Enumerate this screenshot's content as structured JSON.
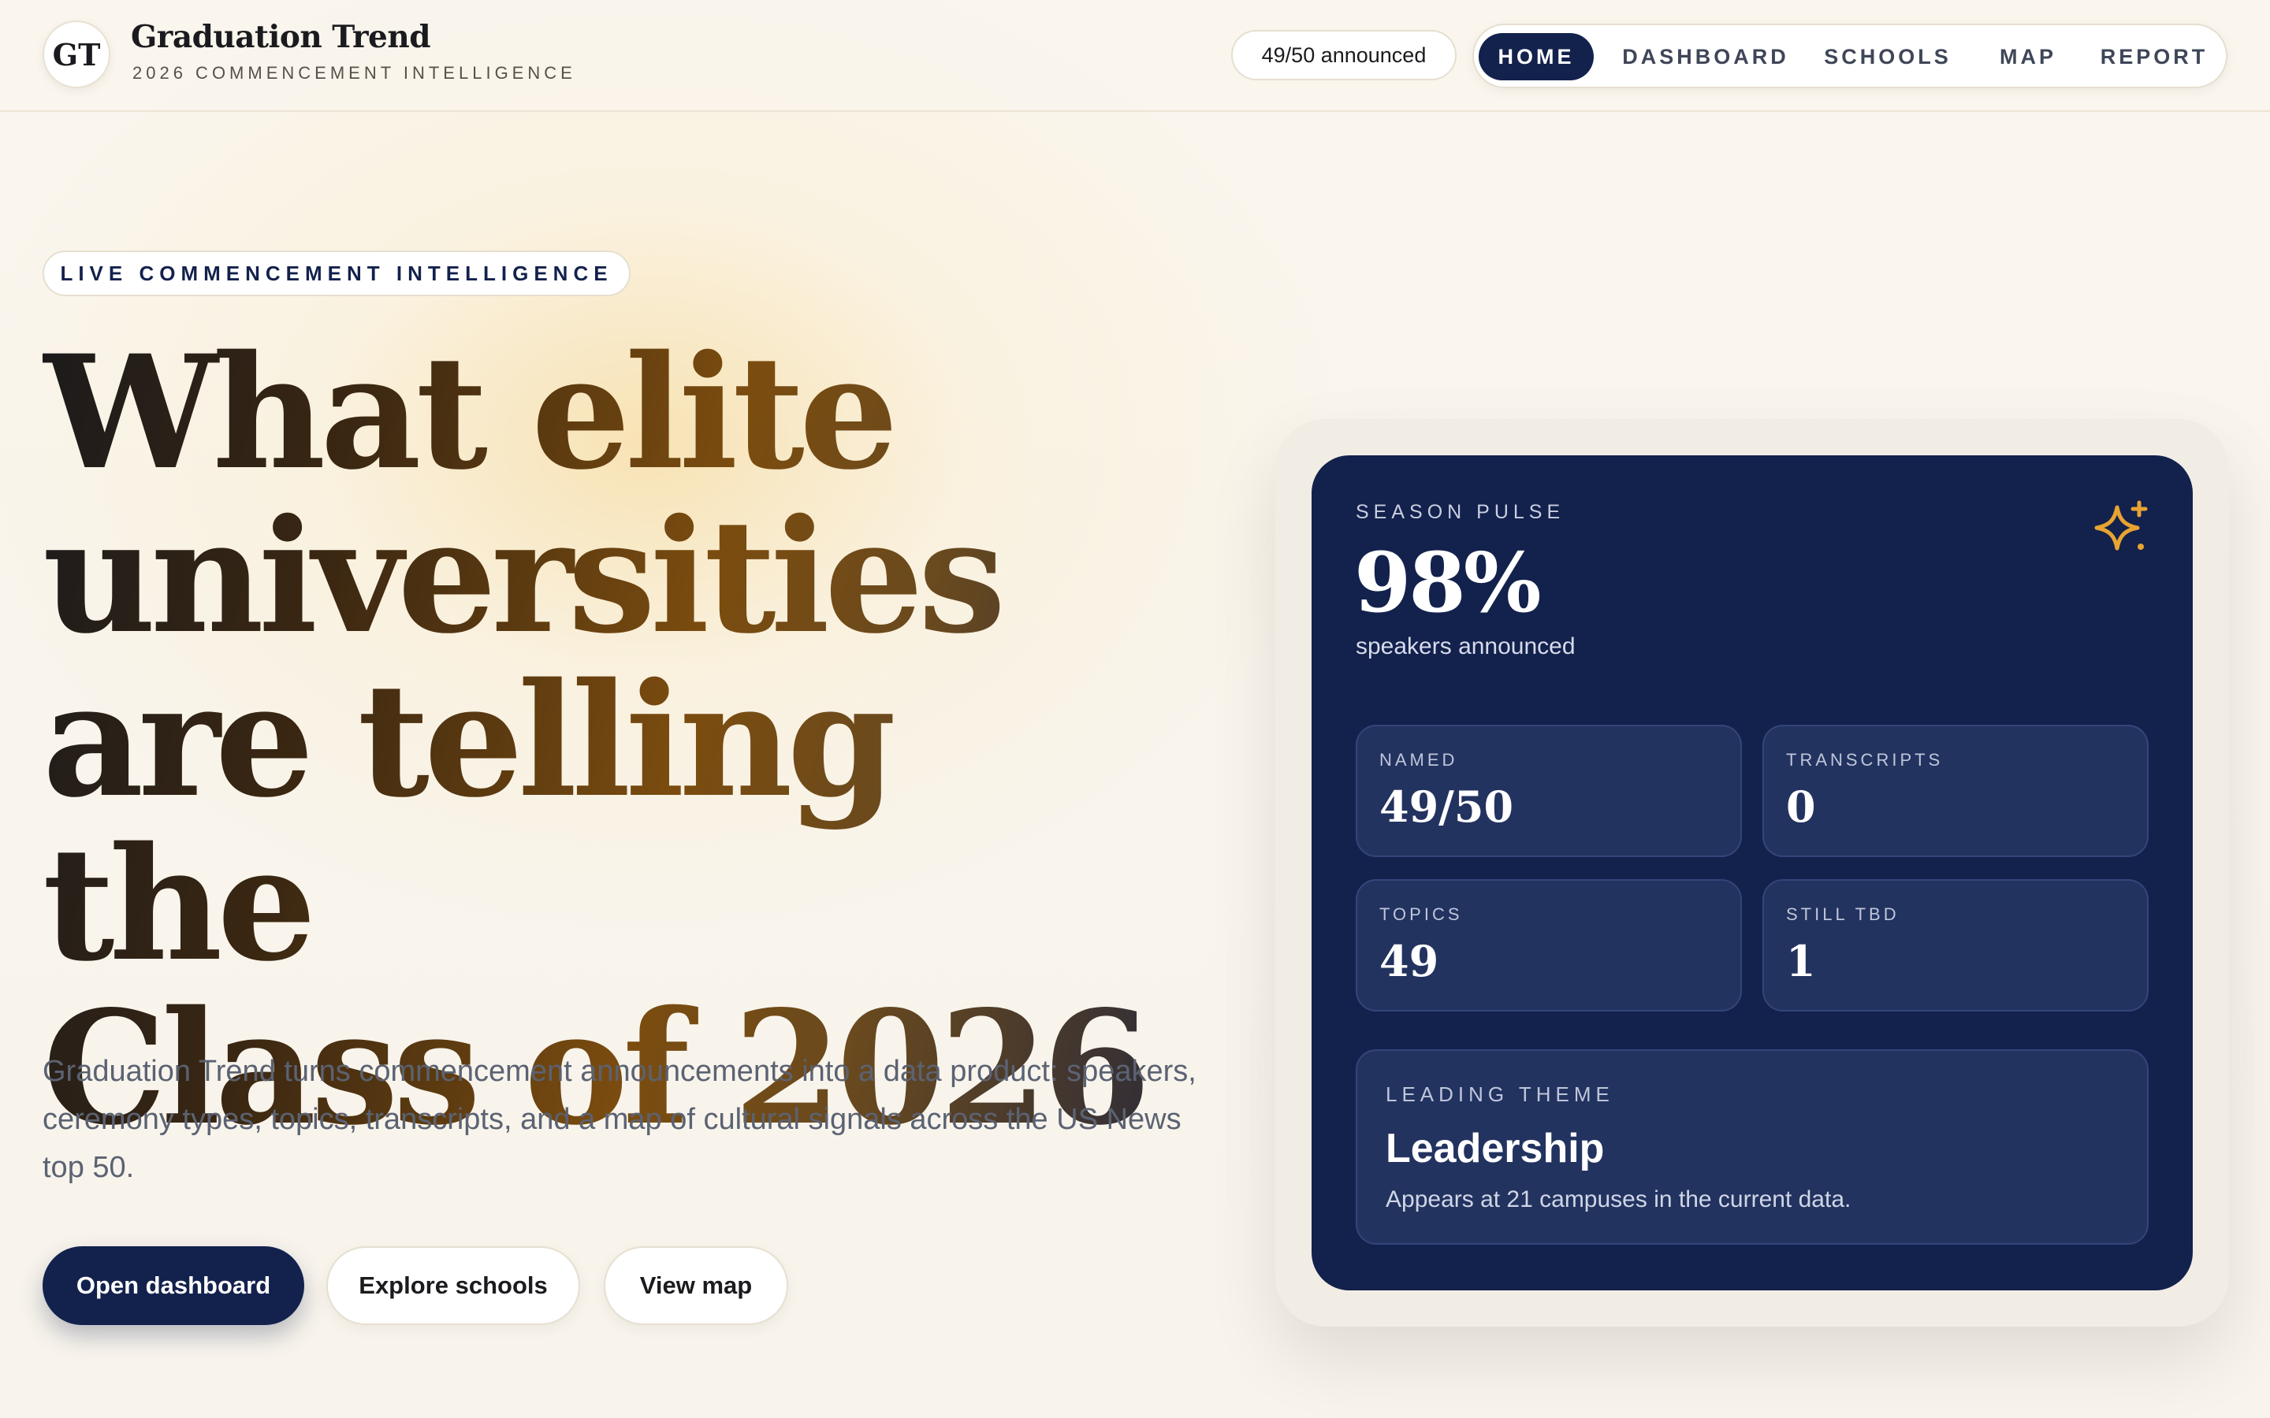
{
  "header": {
    "logo_text": "GT",
    "brand_title": "Graduation Trend",
    "brand_subtitle": "2026 COMMENCEMENT INTELLIGENCE",
    "announced_pill": "49/50 announced",
    "nav": [
      {
        "label": "HOME",
        "active": true
      },
      {
        "label": "DASHBOARD",
        "active": false
      },
      {
        "label": "SCHOOLS",
        "active": false
      },
      {
        "label": "MAP",
        "active": false
      },
      {
        "label": "REPORT",
        "active": false
      }
    ]
  },
  "hero": {
    "eyebrow": "LIVE COMMENCEMENT INTELLIGENCE",
    "headline_lines": [
      "What elite",
      "universities",
      "are telling the",
      "Class of 2026"
    ],
    "lede": "Graduation Trend turns commencement announcements into a data product: speakers, ceremony types, topics, transcripts, and a map of cultural signals across the US News top 50.",
    "buttons": {
      "primary": "Open dashboard",
      "explore": "Explore schools",
      "map": "View map"
    }
  },
  "card": {
    "pulse_label": "SEASON PULSE",
    "pulse_value": "98%",
    "pulse_caption": "speakers announced",
    "icon": "sparkle-icon",
    "stats": [
      {
        "label": "NAMED",
        "value": "49/50"
      },
      {
        "label": "TRANSCRIPTS",
        "value": "0"
      },
      {
        "label": "TOPICS",
        "value": "49"
      },
      {
        "label": "STILL TBD",
        "value": "1"
      }
    ],
    "theme": {
      "label": "LEADING THEME",
      "value": "Leadership",
      "description": "Appears at 21 campuses in the current data."
    }
  },
  "colors": {
    "navy": "#13214d",
    "accent_gold": "#e8a431",
    "background": "#faf6ee"
  }
}
